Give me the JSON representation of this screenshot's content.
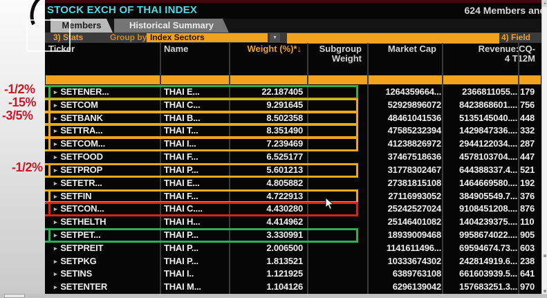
{
  "header": {
    "title": "STOCK EXCH OF THAI INDEX",
    "members_count": "624 Members and",
    "tabs": [
      {
        "label": "Members",
        "active": true
      },
      {
        "label": "Historical Summary",
        "active": false
      }
    ]
  },
  "toolbar": {
    "stats_label": "3) Stats",
    "group_by_label": "Group by",
    "group_by_value": "Index Sectors",
    "dropdown_arrow": "▾",
    "fields_label": "4) Field"
  },
  "table": {
    "columns": [
      {
        "line1": "Ticker",
        "line2": "",
        "align": "left",
        "accent": false
      },
      {
        "line1": "Name",
        "line2": "",
        "align": "left",
        "accent": false
      },
      {
        "line1": "Weight (%)*↓",
        "line2": "",
        "align": "right",
        "accent": true
      },
      {
        "line1": "Subgroup",
        "line2": "Weight",
        "align": "right",
        "accent": false
      },
      {
        "line1": "Market Cap",
        "line2": "",
        "align": "right",
        "accent": false
      },
      {
        "line1": "Revenue:CQ-",
        "line2": "4 T12M",
        "align": "right",
        "accent": false
      },
      {
        "line1": "",
        "line2": "",
        "align": "left",
        "accent": false
      }
    ],
    "expand_icon": "▸",
    "rows": [
      {
        "ticker": "SETENER...",
        "name": "THAI E...",
        "weight": "22.187405",
        "subgroup": "",
        "market_cap": "1264359664...",
        "revenue": "2366811055...",
        "extra": "179",
        "highlight": "green",
        "note": "-1/2%"
      },
      {
        "ticker": "SETCOM",
        "name": "THAI C...",
        "weight": "9.291645",
        "subgroup": "",
        "market_cap": "52929896072",
        "revenue": "8423868601....",
        "extra": "756",
        "highlight": "yellow",
        "note": "-15%"
      },
      {
        "ticker": "SETBANK",
        "name": "THAI B...",
        "weight": "8.502358",
        "subgroup": "",
        "market_cap": "48461041536",
        "revenue": "5135145040....",
        "extra": "448",
        "highlight": "yellow",
        "note": "-3/5%"
      },
      {
        "ticker": "SETTRA...",
        "name": "THAI T...",
        "weight": "8.351490",
        "subgroup": "",
        "market_cap": "47585232394",
        "revenue": "1429847336....",
        "extra": "332",
        "highlight": "yellow",
        "note": ""
      },
      {
        "ticker": "SETCOM...",
        "name": "THAI I...",
        "weight": "7.239469",
        "subgroup": "",
        "market_cap": "41238826972",
        "revenue": "2944122034....",
        "extra": "287",
        "highlight": "yellow",
        "note": ""
      },
      {
        "ticker": "SETFOOD",
        "name": "THAI F...",
        "weight": "6.525177",
        "subgroup": "",
        "market_cap": "37467518636",
        "revenue": "4578103704....",
        "extra": "447",
        "highlight": "",
        "note": ""
      },
      {
        "ticker": "SETPROP",
        "name": "THAI P...",
        "weight": "5.601213",
        "subgroup": "",
        "market_cap": "31778302467",
        "revenue": "644388337.4...",
        "extra": "521",
        "highlight": "yellow",
        "note": "-1/2%"
      },
      {
        "ticker": "SETETR...",
        "name": "THAI E...",
        "weight": "4.805882",
        "subgroup": "",
        "market_cap": "27381815108",
        "revenue": "1464669580....",
        "extra": "192",
        "highlight": "",
        "note": ""
      },
      {
        "ticker": "SETFIN",
        "name": "THAI F...",
        "weight": "4.722913",
        "subgroup": "",
        "market_cap": "27116993052",
        "revenue": "384905549.7...",
        "extra": "376",
        "highlight": "yellow",
        "note": ""
      },
      {
        "ticker": "SETCON...",
        "name": "THAI C....",
        "weight": "4.430280",
        "subgroup": "",
        "market_cap": "25242527024",
        "revenue": "9108451208....",
        "extra": "876",
        "highlight": "red",
        "note": ""
      },
      {
        "ticker": "SETHELTH",
        "name": "THAI H...",
        "weight": "4.414962",
        "subgroup": "",
        "market_cap": "25146401082",
        "revenue": "1404239375....",
        "extra": "110",
        "highlight": "",
        "note": ""
      },
      {
        "ticker": "SETPET...",
        "name": "THAI P...",
        "weight": "3.330991",
        "subgroup": "",
        "market_cap": "18939009468",
        "revenue": "9958674022....",
        "extra": "905",
        "highlight": "green",
        "note": ""
      },
      {
        "ticker": "SETPREIT",
        "name": "THAI P...",
        "weight": "2.006500",
        "subgroup": "",
        "market_cap": "1141611496...",
        "revenue": "69594674.73...",
        "extra": "603",
        "highlight": "",
        "note": ""
      },
      {
        "ticker": "SETPKG",
        "name": "THAI P...",
        "weight": "1.813521",
        "subgroup": "",
        "market_cap": "10333674302",
        "revenue": "242814919.6...",
        "extra": "238",
        "highlight": "",
        "note": ""
      },
      {
        "ticker": "SETINS",
        "name": "THAI I..",
        "weight": "1.121925",
        "subgroup": "",
        "market_cap": "6389763108",
        "revenue": "661603939.5...",
        "extra": "641",
        "highlight": "",
        "note": ""
      },
      {
        "ticker": "SETENTER",
        "name": "THAI M...",
        "weight": "1.104126",
        "subgroup": "",
        "market_cap": "6296139042",
        "revenue": "157683251.3...",
        "extra": "970",
        "highlight": "",
        "note": ""
      }
    ]
  },
  "scrollbar": {
    "up_arrow": "▲"
  },
  "colors": {
    "accent_orange": "#f2a21c",
    "title_cyan": "#55d9e8",
    "highlight_green": "#2fb050",
    "highlight_yellow": "#e9a91c",
    "highlight_red": "#da2318",
    "note_red": "#c31a26"
  }
}
